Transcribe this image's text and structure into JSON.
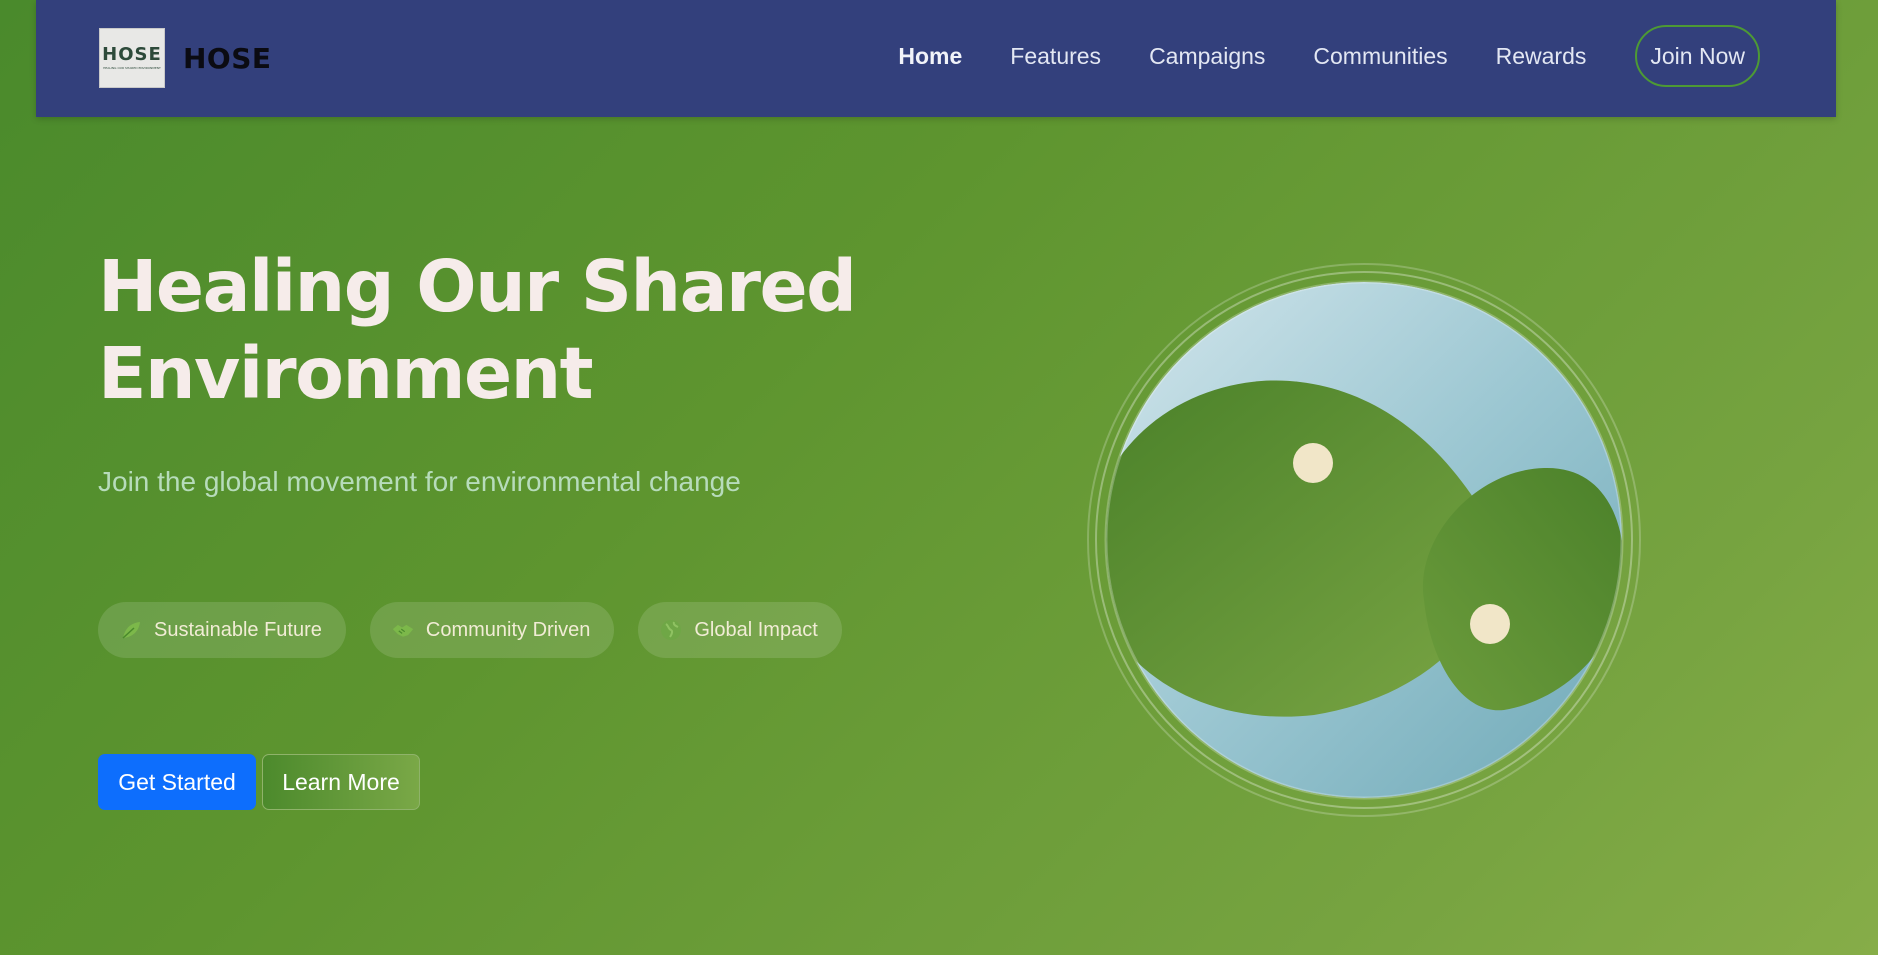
{
  "brand": {
    "logo_text": "HOSE",
    "logo_tagline": "HEALING OUR SHARED ENVIRONMENT",
    "name": "HOSE"
  },
  "nav": {
    "items": [
      {
        "label": "Home",
        "active": true
      },
      {
        "label": "Features"
      },
      {
        "label": "Campaigns"
      },
      {
        "label": "Communities"
      },
      {
        "label": "Rewards"
      }
    ],
    "cta_label": "Join Now"
  },
  "hero": {
    "title_line1": "Healing Our Shared",
    "title_line2": "Environment",
    "subtitle": "Join the global movement for environmental change",
    "pills": [
      {
        "icon": "leaf-icon",
        "label": "Sustainable Future"
      },
      {
        "icon": "handshake-icon",
        "label": "Community Driven"
      },
      {
        "icon": "globe-icon",
        "label": "Global Impact"
      }
    ],
    "primary_button": "Get Started",
    "secondary_button": "Learn More"
  },
  "colors": {
    "nav_bg": "#33407c",
    "primary": "#0d6efd",
    "title": "#f6ecea",
    "subtitle": "#b7dcbb",
    "bg_green": "#5e952f"
  }
}
